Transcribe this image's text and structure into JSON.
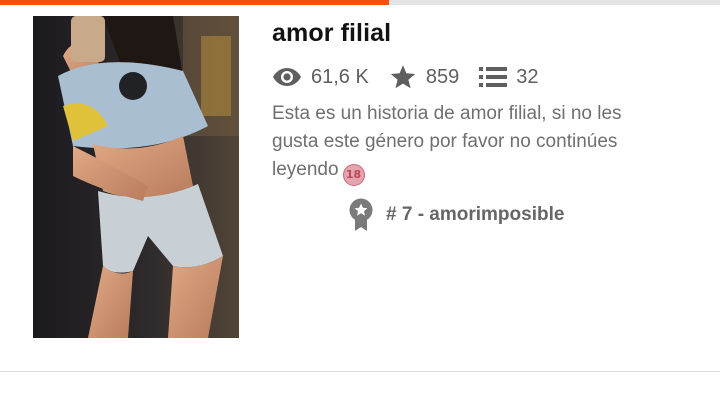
{
  "reading_progress": {
    "fraction": 0.54
  },
  "story": {
    "title": "amor filial",
    "cover_icon": "story-cover-image",
    "stats": {
      "reads": "61,6 K",
      "votes": "859",
      "parts": "32"
    },
    "description": "Esta es un historia de amor filial, si no les gusta este género por favor no continúes leyendo",
    "content_rating": "18",
    "ranking": "# 7 - amorimposible"
  },
  "colors": {
    "accent": "#ff500a",
    "icon_gray": "#5f5f5f"
  }
}
